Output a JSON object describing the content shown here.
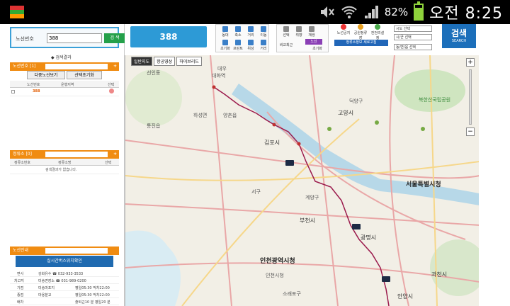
{
  "statusbar": {
    "battery_pct": "82%",
    "clock": "오전 8:25",
    "battery_level": 0.82
  },
  "left": {
    "search": {
      "label": "노선번호",
      "value": "388",
      "button": "검 색"
    },
    "result_label": "◆ 검색결과",
    "route_panel": {
      "title": "노선번호 [1]",
      "plus": "+",
      "tabs": [
        "다중노선보기",
        "선택초기화"
      ],
      "headers": [
        "노선번호",
        "운행지역",
        "선택"
      ],
      "rows": [
        {
          "no": "388",
          "area": ""
        }
      ]
    },
    "stop_panel": {
      "title": "정류소 [0]",
      "plus": "+",
      "headers": [
        "정류소번호",
        "정류소명",
        "선택"
      ],
      "empty": "검색결과가 없습니다."
    },
    "info_panel": {
      "title": "노선안내",
      "realtime": "실시간버스위치확인",
      "rows": [
        [
          "면사",
          "강화유수 ☎ 032-933-3533"
        ],
        [
          "차고지",
          "미송면장소 ☎ 031-989-0200"
        ],
        [
          "기점",
          "미송마포지",
          "평일05:30 막차22:00"
        ],
        [
          "종점",
          "마용분교",
          "평일05:30 막차22:00"
        ],
        [
          "배차",
          "",
          "출퇴근10 분 평일20 분"
        ]
      ]
    }
  },
  "toolbar": {
    "route_button": "388",
    "group1": [
      "동대",
      "축소",
      "거리",
      "이동",
      "초기화",
      "프린트",
      "위성",
      "거리"
    ],
    "group2": [
      "선택",
      "취향",
      "재생",
      "비교최근",
      "삭제",
      "초기화"
    ],
    "group2_button": "노선",
    "group3": [
      "노선공지",
      "공원정류장",
      "전전리설정"
    ],
    "bluebar": "정류소정보 새로고침",
    "selects": [
      "시도 선택",
      "시/군 선택",
      "동/면/읍 선택",
      "노선 선택",
      "시/군 선택"
    ],
    "search_title": "검색",
    "search_sub": "SEARCH"
  },
  "map": {
    "tabs": [
      "일반지도",
      "항공영상",
      "하이브리드"
    ],
    "labels": [
      {
        "t": "대우",
        "cls": ""
      },
      {
        "t": "대화역",
        "cls": ""
      },
      {
        "t": "선인동",
        "cls": ""
      },
      {
        "t": "통진읍",
        "cls": ""
      },
      {
        "t": "하성면",
        "cls": ""
      },
      {
        "t": "양촌읍",
        "cls": ""
      },
      {
        "t": "김포시",
        "cls": "city"
      },
      {
        "t": "고양시",
        "cls": "city"
      },
      {
        "t": "덕양구",
        "cls": ""
      },
      {
        "t": "서울특별시청",
        "cls": "big"
      },
      {
        "t": "인천광역시청",
        "cls": "big"
      },
      {
        "t": "부천시",
        "cls": "city"
      },
      {
        "t": "광명시",
        "cls": "city"
      },
      {
        "t": "계양구",
        "cls": ""
      },
      {
        "t": "서구",
        "cls": ""
      },
      {
        "t": "과천시",
        "cls": "city"
      },
      {
        "t": "안양시",
        "cls": "city"
      },
      {
        "t": "북한산국립공원",
        "cls": "green"
      },
      {
        "t": "인천시청",
        "cls": ""
      },
      {
        "t": "소래포구",
        "cls": ""
      }
    ],
    "zoom_in": "+",
    "zoom_out": "−"
  },
  "colors": {
    "route": "#9b1a4c",
    "accent": "#2d9ad6",
    "panel": "#f08c12"
  }
}
